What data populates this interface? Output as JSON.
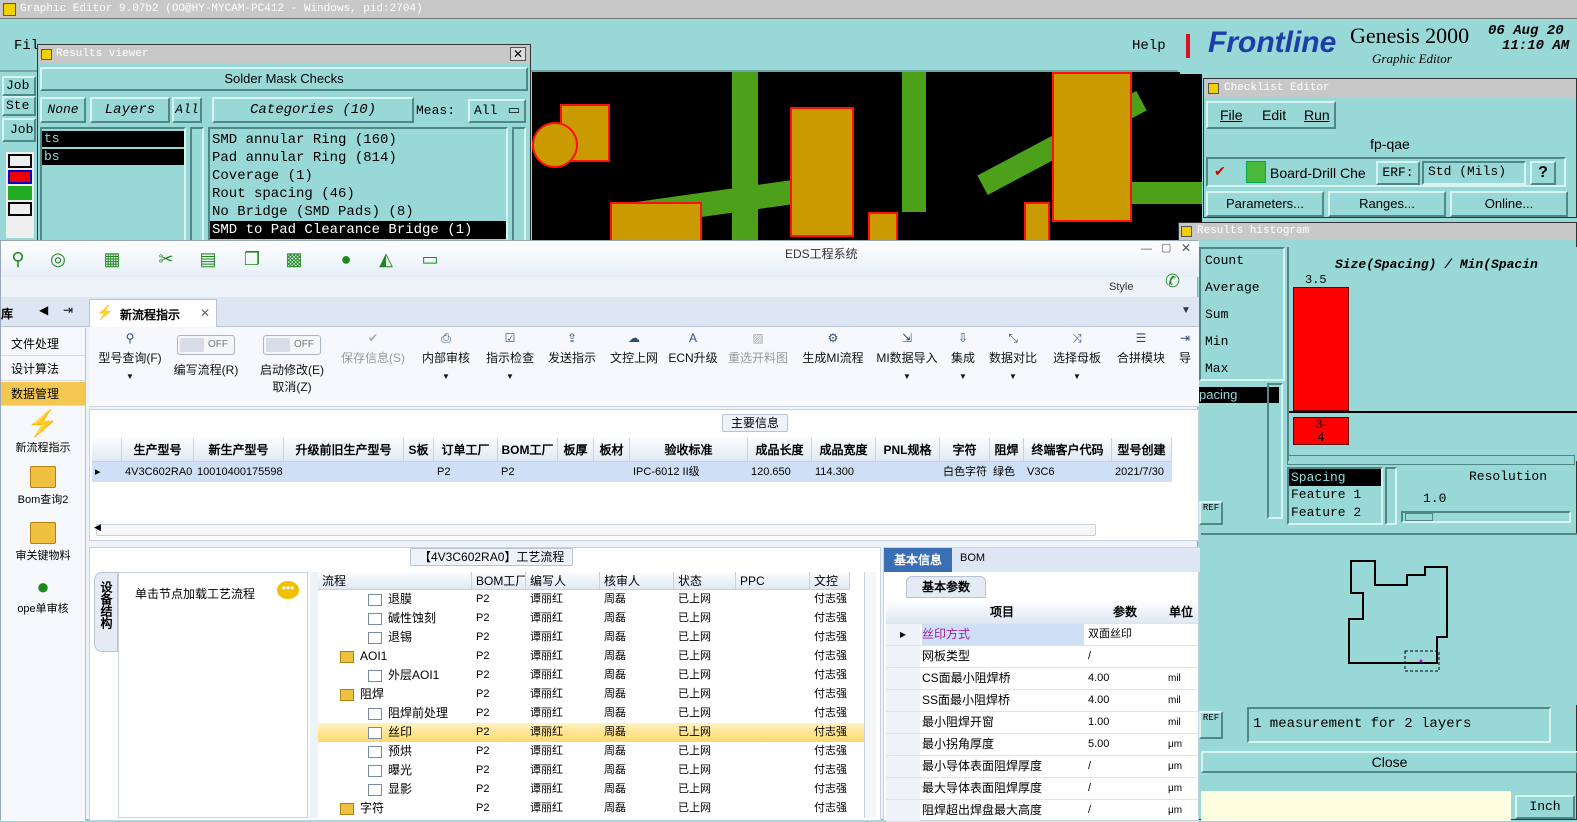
{
  "genesis": {
    "title": "Graphic Editor 9.07b2 (OO@HY-MYCAM-PC412 - Windows, pid:2704)",
    "menu_file": "Fil",
    "help_label": "Help",
    "left_tabs": [
      "Job",
      "Ste",
      "Job"
    ],
    "brand": "Frontline",
    "product": "Genesis 2000",
    "subtitle": "Graphic Editor",
    "date": "06 Aug 20",
    "time": "11:10 AM"
  },
  "results_viewer": {
    "title": "Results viewer",
    "heading": "Solder Mask Checks",
    "none_btn": "None",
    "layers_btn": "Layers",
    "all_btn": "All",
    "categories_label": "Categories (10)",
    "meas_label": "Meas:",
    "meas_value": "All",
    "layers": [
      "ts",
      "bs"
    ],
    "categories": [
      "SMD annular Ring (160)",
      "Pad annular Ring (814)",
      "Coverage (1)",
      "Rout spacing (46)",
      "No Bridge (SMD Pads) (8)",
      "SMD to Pad Clearance Bridge (1)"
    ]
  },
  "checklist_editor": {
    "title": "Checklist Editor",
    "menu": [
      "File",
      "Edit",
      "Run"
    ],
    "checklist_name": "fp-qae",
    "item_name": "Board-Drill Che",
    "erf_label": "ERF:",
    "erf_value": "Std (Mils)",
    "help": "?",
    "buttons": [
      "Parameters...",
      "Ranges...",
      "Online..."
    ]
  },
  "results_histogram": {
    "title": "Results histogram",
    "stats": [
      "Count",
      "Average",
      "Sum",
      "Min",
      "Max"
    ],
    "chart_title": "Size(Spacing) / Min(Spacin",
    "y_tick": "3.5",
    "bin_label": "3-\n4",
    "spacing_selected": "pacing",
    "list": [
      "Spacing",
      "Feature 1",
      "Feature 2"
    ],
    "resolution_label": "Resolution",
    "resolution_value": "1.0",
    "ref_label": "REF",
    "measurement_text": "1 measurement for 2 layers",
    "close_label": "Close",
    "unit_label": "Inch"
  },
  "eds": {
    "title": "EDS工程系统",
    "style_label": "Style",
    "sidebar_header": "库",
    "sidebar_items": [
      "文件处理",
      "设计算法",
      "数据管理"
    ],
    "sidebar_icons": [
      "新流程指示",
      "Bom查询2",
      "审关键物料",
      "ope单审核"
    ],
    "tab_label": "新流程指示",
    "ribbon": {
      "query": "型号查询(F)",
      "edit_flow": "编写流程(R)",
      "start_edit": "启动修改(E)",
      "cancel": "取消(Z)",
      "toggle_off": "OFF",
      "save_info": "保存信息(S)",
      "items": [
        "内部审核",
        "指示检查",
        "发送指示",
        "文控上网",
        "ECN升级",
        "重选开料图",
        "生成MI流程",
        "MI数据导入",
        "集成",
        "数据对比",
        "选择母板",
        "合拼模块",
        "导"
      ]
    },
    "main_info_label": "主要信息",
    "main_columns": [
      "生产型号",
      "新生产型号",
      "升级前旧生产型号",
      "S板",
      "订单工厂",
      "BOM工厂",
      "板厚",
      "板材",
      "验收标准",
      "成品长度",
      "成品宽度",
      "PNL规格",
      "字符",
      "阻焊",
      "终端客户代码",
      "型号创建"
    ],
    "main_row": [
      "4V3C602RA0",
      "10010400175598",
      "",
      "",
      "P2",
      "P2",
      "",
      "",
      "IPC-6012 II级",
      "120.650",
      "114.300",
      "",
      "白色字符",
      "绿色",
      "V3C6",
      "2021/7/30"
    ],
    "process_title": "【4V3C602RA0】工艺流程",
    "device_tab": "设备结构",
    "load_hint": "单击节点加载工艺流程",
    "process_columns": [
      "流程",
      "BOM工厂",
      "编写人",
      "核审人",
      "状态",
      "PPC",
      "文控"
    ],
    "process_rows": [
      {
        "name": "退膜",
        "bom": "P2",
        "writer": "谭丽红",
        "reviewer": "周磊",
        "status": "已上网",
        "ppc": "",
        "doc": "付志强"
      },
      {
        "name": "碱性蚀刻",
        "bom": "P2",
        "writer": "谭丽红",
        "reviewer": "周磊",
        "status": "已上网",
        "ppc": "",
        "doc": "付志强"
      },
      {
        "name": "退锡",
        "bom": "P2",
        "writer": "谭丽红",
        "reviewer": "周磊",
        "status": "已上网",
        "ppc": "",
        "doc": "付志强"
      },
      {
        "name": "AOI1",
        "bom": "P2",
        "writer": "谭丽红",
        "reviewer": "周磊",
        "status": "已上网",
        "ppc": "",
        "doc": "付志强"
      },
      {
        "name": "外层AOI1",
        "bom": "P2",
        "writer": "谭丽红",
        "reviewer": "周磊",
        "status": "已上网",
        "ppc": "",
        "doc": "付志强"
      },
      {
        "name": "阻焊",
        "bom": "P2",
        "writer": "谭丽红",
        "reviewer": "周磊",
        "status": "已上网",
        "ppc": "",
        "doc": "付志强"
      },
      {
        "name": "阻焊前处理",
        "bom": "P2",
        "writer": "谭丽红",
        "reviewer": "周磊",
        "status": "已上网",
        "ppc": "",
        "doc": "付志强"
      },
      {
        "name": "丝印",
        "bom": "P2",
        "writer": "谭丽红",
        "reviewer": "周磊",
        "status": "已上网",
        "ppc": "",
        "doc": "付志强"
      },
      {
        "name": "预烘",
        "bom": "P2",
        "writer": "谭丽红",
        "reviewer": "周磊",
        "status": "已上网",
        "ppc": "",
        "doc": "付志强"
      },
      {
        "name": "曝光",
        "bom": "P2",
        "writer": "谭丽红",
        "reviewer": "周磊",
        "status": "已上网",
        "ppc": "",
        "doc": "付志强"
      },
      {
        "name": "显影",
        "bom": "P2",
        "writer": "谭丽红",
        "reviewer": "周磊",
        "status": "已上网",
        "ppc": "",
        "doc": "付志强"
      },
      {
        "name": "字符",
        "bom": "P2",
        "writer": "谭丽红",
        "reviewer": "周磊",
        "status": "已上网",
        "ppc": "",
        "doc": "付志强"
      }
    ],
    "info_tabs": [
      "基本信息",
      "BOM"
    ],
    "basic_params_label": "基本参数",
    "prop_columns": [
      "项目",
      "参数",
      "单位"
    ],
    "props": [
      {
        "item": "丝印方式",
        "value": "双面丝印",
        "unit": ""
      },
      {
        "item": "网板类型",
        "value": "/",
        "unit": ""
      },
      {
        "item": "CS面最小阻焊桥",
        "value": "4.00",
        "unit": "mil"
      },
      {
        "item": "SS面最小阻焊桥",
        "value": "4.00",
        "unit": "mil"
      },
      {
        "item": "最小阻焊开窗",
        "value": "1.00",
        "unit": "mil"
      },
      {
        "item": "最小拐角厚度",
        "value": "5.00",
        "unit": "μm"
      },
      {
        "item": "最小导体表面阻焊厚度",
        "value": "/",
        "unit": "μm"
      },
      {
        "item": "最大导体表面阻焊厚度",
        "value": "/",
        "unit": "μm"
      },
      {
        "item": "阻焊超出焊盘最大高度",
        "value": "/",
        "unit": "μm"
      }
    ]
  }
}
